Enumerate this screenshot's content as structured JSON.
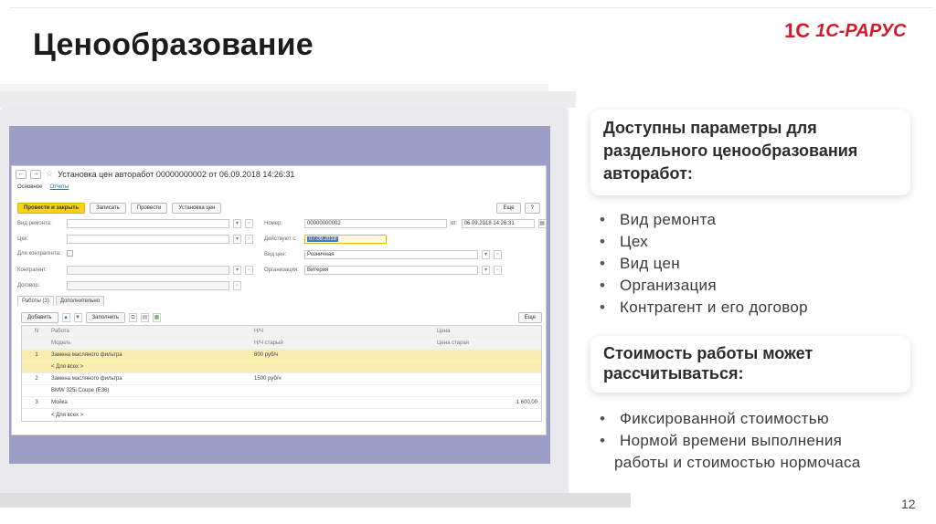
{
  "slide": {
    "title": "Ценообразование",
    "page_number": "12",
    "logo": {
      "brand_a": "1С",
      "brand_b": "1С-РАРУС"
    }
  },
  "right": {
    "card1": "Доступны параметры для раздельного ценообразования авторабот:",
    "list1": [
      "Вид ремонта",
      "Цех",
      "Вид цен",
      "Организация",
      "Контрагент и его договор"
    ],
    "card2": "Стоимость работы может рассчитываться:",
    "list2": [
      "Фиксированной стоимостью",
      "Нормой времени выполнения",
      "работы и стоимостью нормочаса"
    ]
  },
  "window": {
    "title": "Установка цен авторабот 00000000002 от 06.09.2018 14:26:31",
    "tabs": [
      "Основное",
      "Отчеты"
    ],
    "toolbar": [
      "Провести и закрыть",
      "Записать",
      "Провести",
      "Установка цен"
    ],
    "more": "Еще",
    "help": "?",
    "fields": {
      "repair_type": "Вид ремонта:",
      "shop": "Цех:",
      "for_contractor": "Для контрагента:",
      "contractor": "Контрагент:",
      "contract": "Договор:",
      "number_label": "Номер:",
      "number_value": "00000000002",
      "from_label": "от:",
      "from_value": "06.09.2018 14:26:31",
      "valid_from_label": "Действуют с:",
      "valid_from_value": "07.09.2018",
      "price_type_label": "Вид цен:",
      "price_type_value": "Розничная",
      "org_label": "Организация:",
      "org_value": "Витерия"
    },
    "subtabs": [
      "Работы (3)",
      "Дополнительно"
    ],
    "table_toolbar": [
      "Добавить",
      "Заполнить",
      "Еще"
    ],
    "table": {
      "headers": [
        "N",
        "Работа",
        "Н/Ч",
        "Цена"
      ],
      "subheaders": [
        "",
        "Модель",
        "Н/Ч старый",
        "Цена старая"
      ],
      "rows": [
        {
          "n": "1",
          "work": "Замена масляного фильтра",
          "nh": "800 руб/ч",
          "price": "",
          "model": "< Для всех >"
        },
        {
          "n": "2",
          "work": "Замена масляного фильтра",
          "nh": "1500 руб/ч",
          "price": "",
          "model": "BMW 325i Coupe (E36)"
        },
        {
          "n": "3",
          "work": "Мойка",
          "nh": "",
          "price": "1 600,00",
          "model": "< Для всех >"
        }
      ]
    }
  },
  "colors": {
    "accent": "#d6192a",
    "screen_bg": "#9d9ec6",
    "highlight": "#faecb0"
  }
}
